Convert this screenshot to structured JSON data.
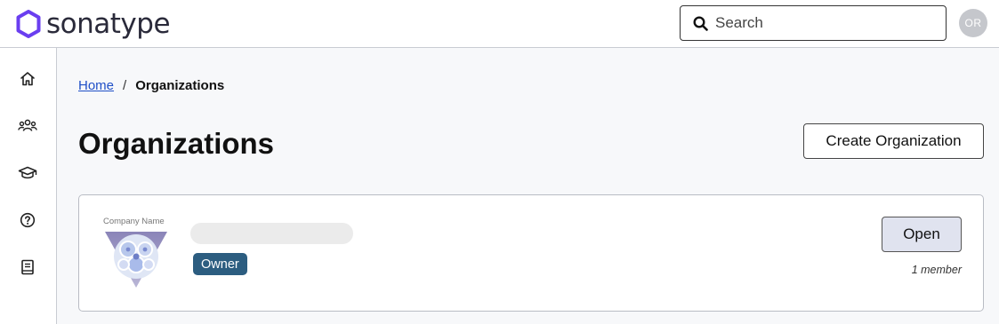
{
  "header": {
    "brand": "sonatype",
    "search_placeholder": "Search",
    "avatar_initials": "OR",
    "brand_color": "#6a3ef0"
  },
  "sidebar": {
    "items": [
      {
        "icon": "home-icon"
      },
      {
        "icon": "users-icon"
      },
      {
        "icon": "graduation-cap-icon"
      },
      {
        "icon": "help-icon"
      },
      {
        "icon": "book-icon"
      }
    ]
  },
  "breadcrumb": {
    "home": "Home",
    "separator": "/",
    "current": "Organizations"
  },
  "page": {
    "title": "Organizations",
    "create_button": "Create Organization"
  },
  "organizations": [
    {
      "logo_caption": "Company Name",
      "role": "Owner",
      "open_button": "Open",
      "members": "1 member",
      "badge_color": "#2c5d80"
    }
  ]
}
